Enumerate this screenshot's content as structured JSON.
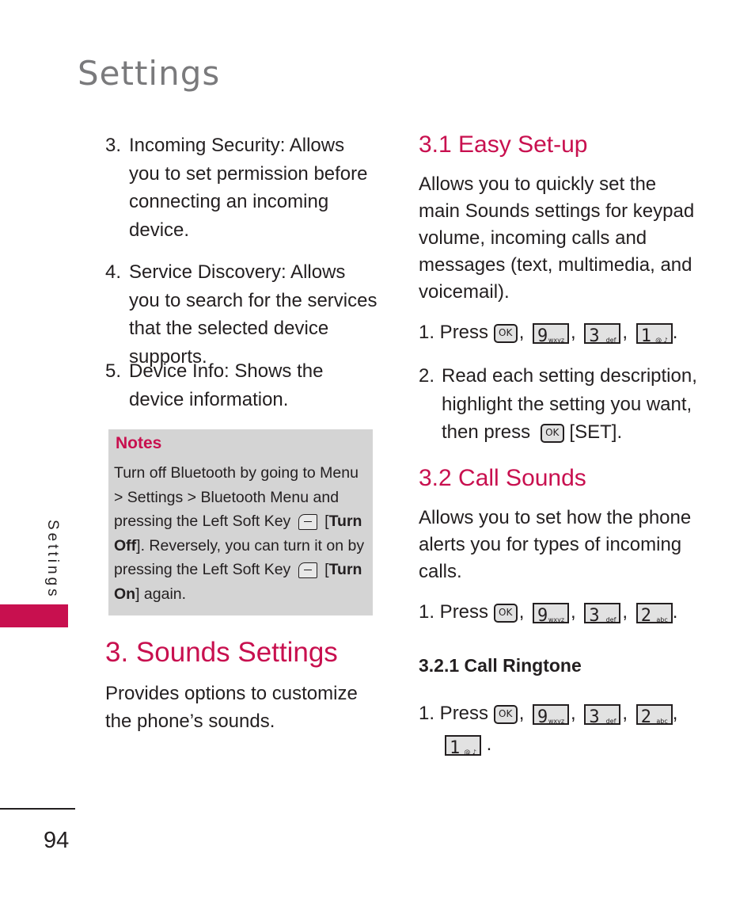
{
  "header": {
    "title": "Settings"
  },
  "side_tab": {
    "label": "Settings",
    "accent_color": "#c8104f"
  },
  "left_column": {
    "list": [
      {
        "num": "3.",
        "text": "Incoming Security: Allows you to set permission before connecting an incoming device."
      },
      {
        "num": "4.",
        "text": "Service Discovery: Allows you to search for the services that the selected device supports."
      },
      {
        "num": "5.",
        "text": "Device Info: Shows the device information."
      }
    ],
    "notes": {
      "title": "Notes",
      "line1": "Turn off Bluetooth by going to Menu > Settings > Bluetooth Menu and pressing the Left Soft Key",
      "turn_off": "Turn Off",
      "line2": ". Reversely, you can turn it on by pressing the Left Soft Key",
      "turn_on": "Turn On",
      "line3": " again."
    },
    "section_title": "3. Sounds Settings",
    "section_desc": "Provides options to customize the phone’s sounds."
  },
  "right_column": {
    "easy_setup": {
      "title": "3.1 Easy Set-up",
      "desc": "Allows you to quickly set the main Sounds settings for keypad volume, incoming calls and messages (text, multimedia, and voicemail).",
      "step1_label": "1. Press",
      "step1_keys": [
        "OK",
        "9",
        "3",
        "1"
      ],
      "step2_num": "2.",
      "step2_text": "Read each setting description, highlight the setting you want, then press",
      "step2_key": "OK",
      "step2_action": "SET"
    },
    "call_sounds": {
      "title": "3.2 Call Sounds",
      "desc": "Allows you to set how the phone alerts you for types of incoming calls.",
      "step1_label": "1. Press",
      "step1_keys": [
        "OK",
        "9",
        "3",
        "2"
      ]
    },
    "call_ringtone": {
      "title": "3.2.1 Call Ringtone",
      "step1_label": "1. Press",
      "step1_keys": [
        "OK",
        "9",
        "3",
        "2",
        "1"
      ]
    }
  },
  "keys": {
    "ok": "OK",
    "k9": {
      "digit": "9",
      "letters": "wxyz"
    },
    "k3": {
      "digit": "3",
      "letters": "def"
    },
    "k2": {
      "digit": "2",
      "letters": "abc"
    },
    "k1": {
      "digit": "1",
      "letters": "@ ♪"
    }
  },
  "footer": {
    "page_number": "94"
  }
}
